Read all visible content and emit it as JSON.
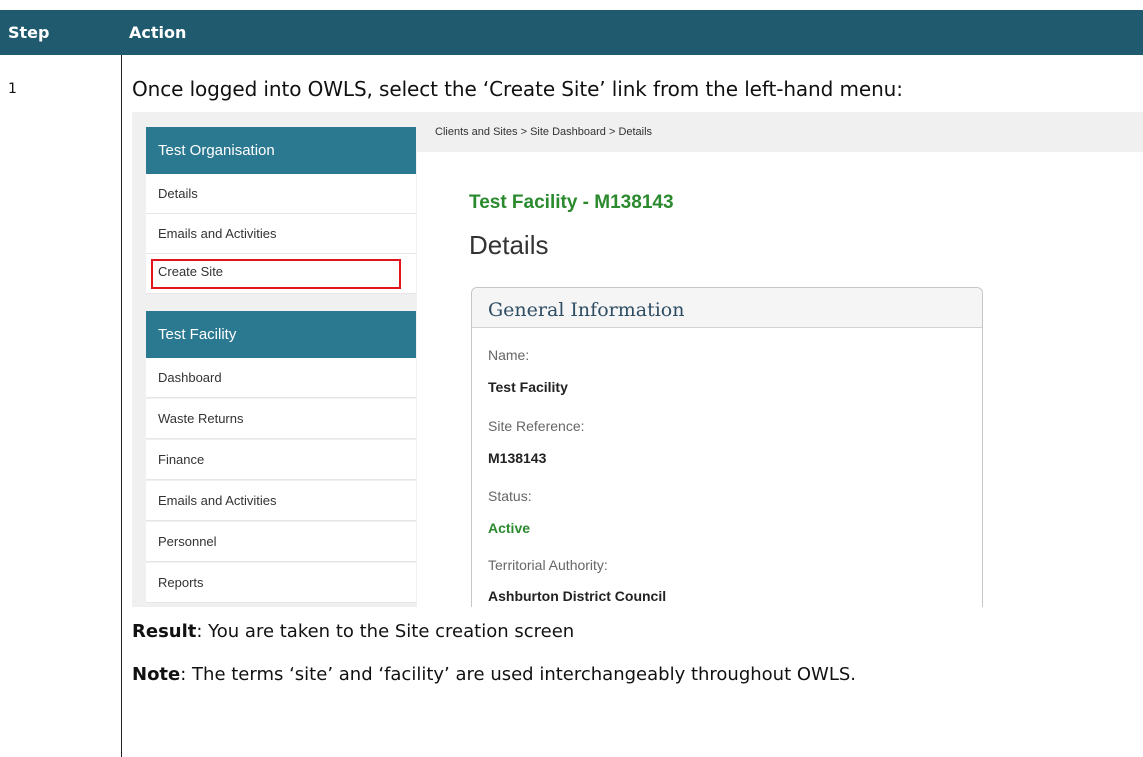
{
  "table": {
    "header": {
      "step": "Step",
      "action": "Action"
    },
    "row": {
      "step": "1",
      "instruction": "Once logged into OWLS, select the ‘Create Site’ link from the left-hand menu:",
      "result_label": "Result",
      "result_text": ": You are taken to the Site creation screen",
      "note_label": "Note",
      "note_text": ": The terms ‘site’ and ‘facility’ are used interchangeably throughout OWLS."
    }
  },
  "screenshot": {
    "org_menu": {
      "heading": "Test Organisation",
      "items": [
        "Details",
        "Emails and Activities",
        "Create Site"
      ]
    },
    "facility_menu": {
      "heading": "Test Facility",
      "items": [
        "Dashboard",
        "Waste Returns",
        "Finance",
        "Emails and Activities",
        "Personnel",
        "Reports"
      ]
    },
    "breadcrumb": "Clients and Sites  >  Site Dashboard  >  Details",
    "facility_title": "Test Facility - M138143",
    "page_title": "Details",
    "general_info": {
      "heading": "General Information",
      "name_label": "Name:",
      "name_value": "Test Facility",
      "ref_label": "Site Reference:",
      "ref_value": "M138143",
      "status_label": "Status:",
      "status_value": "Active",
      "ta_label": "Territorial Authority:",
      "ta_value": "Ashburton District Council"
    },
    "highlight_color": "#e0151b",
    "menu_heading_color": "#2b7891",
    "facility_title_color": "#2b8a2e"
  }
}
